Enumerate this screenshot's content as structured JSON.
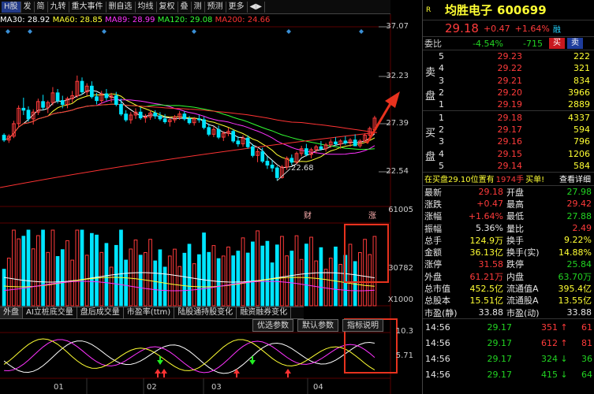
{
  "toolbar": {
    "items": [
      "H股",
      "发",
      "简",
      "九转",
      "重大事件",
      "删自选",
      "均线",
      "复权",
      "叠",
      "测",
      "预测",
      "更多"
    ],
    "selected": 0
  },
  "ma_legend": {
    "ma30": "MA30: 28.92",
    "ma60": "MA60: 28.85",
    "ma89": "MA89: 28.99",
    "ma120": "MA120: 29.08",
    "ma200": "MA200: 24.66"
  },
  "price_axis": [
    "37.07",
    "32.23",
    "27.39",
    "22.54"
  ],
  "low_label": "22.68",
  "event_markers": [
    "财",
    "涨"
  ],
  "vol_axis": [
    "61005",
    "30782",
    "X1000"
  ],
  "bottom_tabs": [
    "外盘",
    "AI立桩底交量",
    "盘后成交量",
    "市盈率(ttm)",
    "陆股通持股变化",
    "融资融券变化"
  ],
  "indicator_btns": [
    "优选参数",
    "默认参数",
    "指标说明"
  ],
  "ind_axis": [
    "10.3",
    "5.71"
  ],
  "date_labels": [
    "01",
    "02",
    "03",
    "04"
  ],
  "stock": {
    "r": "R",
    "name": "均胜电子",
    "code": "600699",
    "price": "29.18",
    "chg": "+0.47",
    "pct": "+1.64%",
    "flag": "融"
  },
  "weibi": {
    "label": "委比",
    "ratio": "-4.54%",
    "diff": "-715",
    "buy": "买",
    "sell": "卖"
  },
  "asks": [
    {
      "n": "5",
      "p": "29.23",
      "v": "222"
    },
    {
      "n": "4",
      "p": "29.22",
      "v": "321"
    },
    {
      "n": "3",
      "p": "29.21",
      "v": "834"
    },
    {
      "n": "2",
      "p": "29.20",
      "v": "3966"
    },
    {
      "n": "1",
      "p": "29.19",
      "v": "2889"
    }
  ],
  "bids": [
    {
      "n": "1",
      "p": "29.18",
      "v": "4337"
    },
    {
      "n": "2",
      "p": "29.17",
      "v": "594"
    },
    {
      "n": "3",
      "p": "29.16",
      "v": "796"
    },
    {
      "n": "4",
      "p": "29.15",
      "v": "1206"
    },
    {
      "n": "5",
      "p": "29.14",
      "v": "584"
    }
  ],
  "sell_side": [
    "卖",
    "盘"
  ],
  "buy_side": [
    "买",
    "盘"
  ],
  "notice": {
    "text": "在买盘29.10位置有",
    "qty": "1974手",
    "tail": "买单!",
    "link": "查看详细"
  },
  "quote": [
    {
      "l1": "最新",
      "v1": "29.18",
      "c1": "red",
      "l2": "开盘",
      "v2": "27.98",
      "c2": "green"
    },
    {
      "l1": "涨跌",
      "v1": "+0.47",
      "c1": "red",
      "l2": "最高",
      "v2": "29.42",
      "c2": "red"
    },
    {
      "l1": "涨幅",
      "v1": "+1.64%",
      "c1": "red",
      "l2": "最低",
      "v2": "27.88",
      "c2": "green"
    },
    {
      "l1": "振幅",
      "v1": "5.36%",
      "c1": "white",
      "l2": "量比",
      "v2": "2.49",
      "c2": "red"
    },
    {
      "l1": "总手",
      "v1": "124.9万",
      "c1": "yellow",
      "l2": "换手",
      "v2": "9.22%",
      "c2": "yellow"
    },
    {
      "l1": "金额",
      "v1": "36.13亿",
      "c1": "yellow",
      "l2": "换手(实)",
      "v2": "14.88%",
      "c2": "yellow"
    },
    {
      "l1": "涨停",
      "v1": "31.58",
      "c1": "red",
      "l2": "跌停",
      "v2": "25.84",
      "c2": "green"
    },
    {
      "l1": "外盘",
      "v1": "61.21万",
      "c1": "red",
      "l2": "内盘",
      "v2": "63.70万",
      "c2": "green"
    },
    {
      "l1": "总市值",
      "v1": "452.5亿",
      "c1": "yellow",
      "l2": "流通值A",
      "v2": "395.4亿",
      "c2": "yellow"
    },
    {
      "l1": "总股本",
      "v1": "15.51亿",
      "c1": "yellow",
      "l2": "流通股A",
      "v2": "13.55亿",
      "c2": "yellow"
    },
    {
      "l1": "市盈(静)",
      "v1": "33.88",
      "c1": "white",
      "l2": "市盈(动)",
      "v2": "33.88",
      "c2": "white"
    }
  ],
  "ticks": [
    {
      "t": "14:56",
      "p": "29.17",
      "v": "351",
      "d": "up",
      "n": "61"
    },
    {
      "t": "14:56",
      "p": "29.17",
      "v": "612",
      "d": "up",
      "n": "81"
    },
    {
      "t": "14:56",
      "p": "29.17",
      "v": "324",
      "d": "down",
      "n": "36"
    },
    {
      "t": "14:56",
      "p": "29.17",
      "v": "415",
      "d": "down",
      "n": "64"
    }
  ],
  "chart_data": {
    "type": "candlestick",
    "price_range": [
      20.0,
      38.5
    ],
    "candles": [
      [
        27.4,
        27.6,
        26.7,
        26.9
      ],
      [
        26.9,
        27.5,
        26.6,
        27.3
      ],
      [
        27.3,
        28.9,
        27.1,
        28.6
      ],
      [
        28.6,
        30.5,
        28.3,
        30.2
      ],
      [
        30.2,
        31.3,
        29.5,
        30.0
      ],
      [
        30.0,
        30.4,
        28.8,
        29.1
      ],
      [
        29.1,
        30.1,
        28.5,
        29.8
      ],
      [
        29.8,
        31.2,
        29.5,
        30.9
      ],
      [
        30.9,
        31.6,
        30.0,
        30.3
      ],
      [
        30.3,
        31.0,
        29.7,
        30.8
      ],
      [
        30.8,
        32.4,
        30.5,
        31.8
      ],
      [
        31.8,
        32.2,
        30.7,
        31.0
      ],
      [
        31.0,
        31.5,
        30.2,
        30.6
      ],
      [
        30.6,
        31.4,
        30.2,
        31.2
      ],
      [
        31.2,
        32.0,
        30.8,
        31.5
      ],
      [
        31.5,
        33.6,
        31.3,
        33.0
      ],
      [
        33.0,
        33.4,
        31.6,
        31.9
      ],
      [
        31.9,
        32.8,
        31.5,
        32.5
      ],
      [
        32.5,
        33.0,
        31.2,
        31.4
      ],
      [
        31.4,
        31.8,
        30.6,
        31.0
      ],
      [
        31.0,
        32.0,
        30.7,
        31.7
      ],
      [
        31.7,
        32.2,
        31.0,
        31.3
      ],
      [
        31.3,
        31.8,
        30.8,
        31.5
      ],
      [
        31.5,
        31.9,
        30.4,
        30.6
      ],
      [
        30.6,
        31.2,
        29.4,
        29.6
      ],
      [
        29.6,
        30.0,
        28.8,
        29.0
      ],
      [
        29.0,
        29.8,
        28.6,
        29.5
      ],
      [
        29.5,
        30.2,
        29.1,
        29.8
      ],
      [
        29.8,
        30.3,
        29.0,
        29.2
      ],
      [
        29.2,
        29.6,
        28.7,
        29.3
      ],
      [
        29.3,
        30.0,
        29.0,
        29.7
      ],
      [
        29.7,
        30.0,
        29.1,
        29.4
      ],
      [
        29.4,
        29.8,
        28.9,
        29.1
      ],
      [
        29.1,
        29.6,
        28.6,
        28.8
      ],
      [
        28.8,
        29.3,
        28.3,
        29.0
      ],
      [
        29.0,
        29.5,
        28.7,
        29.3
      ],
      [
        29.3,
        29.9,
        29.0,
        29.6
      ],
      [
        29.6,
        29.9,
        28.9,
        29.1
      ],
      [
        29.1,
        29.4,
        28.5,
        28.7
      ],
      [
        28.7,
        29.3,
        28.4,
        29.1
      ],
      [
        29.1,
        29.5,
        28.7,
        29.0
      ],
      [
        29.0,
        29.3,
        28.0,
        28.2
      ],
      [
        28.2,
        28.6,
        27.3,
        27.5
      ],
      [
        27.5,
        28.3,
        27.2,
        28.0
      ],
      [
        28.0,
        28.4,
        27.0,
        27.2
      ],
      [
        27.2,
        27.8,
        26.8,
        27.6
      ],
      [
        27.6,
        28.2,
        27.3,
        27.8
      ],
      [
        27.8,
        28.0,
        26.6,
        26.8
      ],
      [
        26.8,
        27.3,
        26.2,
        26.5
      ],
      [
        26.5,
        27.4,
        26.2,
        27.1
      ],
      [
        27.1,
        27.4,
        26.0,
        26.2
      ],
      [
        26.2,
        26.5,
        25.1,
        25.3
      ],
      [
        25.3,
        26.0,
        24.6,
        25.7
      ],
      [
        25.7,
        26.1,
        24.5,
        24.7
      ],
      [
        24.7,
        25.2,
        23.9,
        24.3
      ],
      [
        24.3,
        24.8,
        23.6,
        24.0
      ],
      [
        24.0,
        24.2,
        22.68,
        23.0
      ],
      [
        23.0,
        24.3,
        22.9,
        24.1
      ],
      [
        24.1,
        25.2,
        23.8,
        25.0
      ],
      [
        25.0,
        25.4,
        24.3,
        24.6
      ],
      [
        24.6,
        25.7,
        24.4,
        25.5
      ],
      [
        25.5,
        26.3,
        25.2,
        26.0
      ],
      [
        26.0,
        26.5,
        25.2,
        25.4
      ],
      [
        25.4,
        26.1,
        25.0,
        25.9
      ],
      [
        25.9,
        26.4,
        25.5,
        26.2
      ],
      [
        26.2,
        26.8,
        25.8,
        26.0
      ],
      [
        26.0,
        26.6,
        25.7,
        26.4
      ],
      [
        26.4,
        27.0,
        26.1,
        26.7
      ],
      [
        26.7,
        27.2,
        26.3,
        26.5
      ],
      [
        26.5,
        27.0,
        26.0,
        26.8
      ],
      [
        26.8,
        27.3,
        26.4,
        26.6
      ],
      [
        26.6,
        27.1,
        26.2,
        26.9
      ],
      [
        26.9,
        27.5,
        26.5,
        26.3
      ],
      [
        26.3,
        27.0,
        26.1,
        26.8
      ],
      [
        26.8,
        27.6,
        26.6,
        27.4
      ],
      [
        27.4,
        28.3,
        27.1,
        28.1
      ],
      [
        27.98,
        29.42,
        27.88,
        29.18
      ]
    ],
    "ma_series": [
      {
        "name": "MA30",
        "color": "#ffffff"
      },
      {
        "name": "MA60",
        "color": "#ffff33"
      },
      {
        "name": "MA89",
        "color": "#ff33ff"
      },
      {
        "name": "MA120",
        "color": "#33ff33"
      },
      {
        "name": "MA200",
        "color": "#ff3333"
      }
    ]
  },
  "colors": {
    "up": "#ff3b3b",
    "down": "#00e5ff",
    "ma30": "#ffffff",
    "ma60": "#ffff33",
    "ma89": "#ff33ff",
    "ma120": "#33ff33",
    "ma200": "#ff3333",
    "annotation": "#e8321e"
  }
}
